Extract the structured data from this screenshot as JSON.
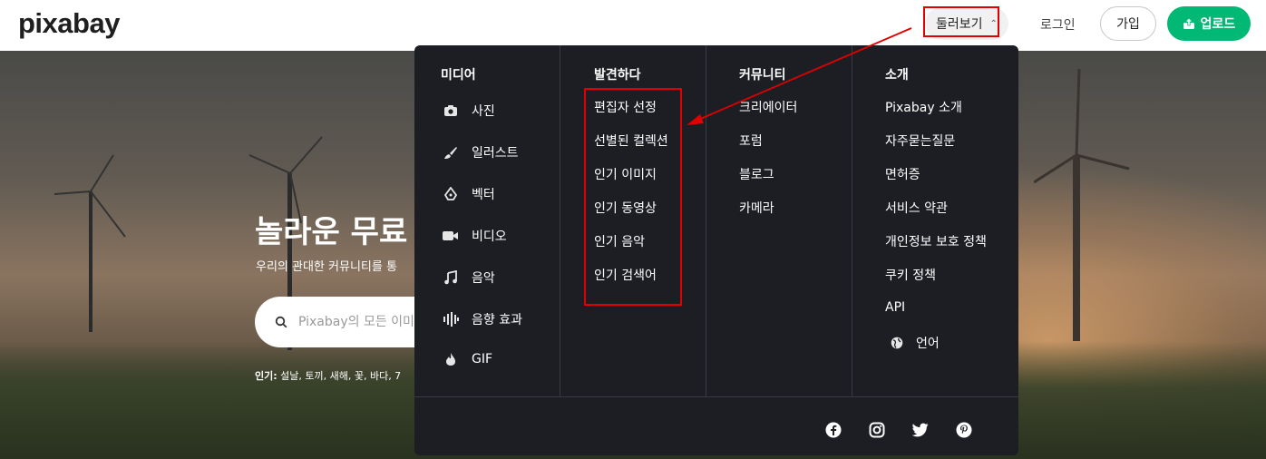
{
  "header": {
    "logo": "pixabay",
    "explore_label": "둘러보기",
    "login_label": "로그인",
    "join_label": "가입",
    "upload_label": "업로드"
  },
  "hero": {
    "title": "놀라운 무료",
    "subtitle": "우리의 관대한 커뮤니티를 통",
    "search_placeholder": "Pixabay의 모든 이미",
    "popular_label": "인기:",
    "popular_terms": "설날, 토끼, 새해, 꽃, 바다, 7"
  },
  "menu": {
    "media": {
      "heading": "미디어",
      "items": [
        {
          "label": "사진",
          "icon": "camera-icon"
        },
        {
          "label": "일러스트",
          "icon": "brush-icon"
        },
        {
          "label": "벡터",
          "icon": "pen-nib-icon"
        },
        {
          "label": "비디오",
          "icon": "video-icon"
        },
        {
          "label": "음악",
          "icon": "music-note-icon"
        },
        {
          "label": "음향 효과",
          "icon": "sound-wave-icon"
        },
        {
          "label": "GIF",
          "icon": "flame-icon"
        }
      ]
    },
    "discover": {
      "heading": "발견하다",
      "items": [
        "편집자 선정",
        "선별된 컬렉션",
        "인기 이미지",
        "인기 동영상",
        "인기 음악",
        "인기 검색어"
      ]
    },
    "community": {
      "heading": "커뮤니티",
      "items": [
        "크리에이터",
        "포럼",
        "블로그",
        "카메라"
      ]
    },
    "about": {
      "heading": "소개",
      "items": [
        "Pixabay 소개",
        "자주묻는질문",
        "면허증",
        "서비스 약관",
        "개인정보 보호 정책",
        "쿠키 정책",
        "API"
      ],
      "language_label": "언어"
    },
    "social": [
      "facebook-icon",
      "instagram-icon",
      "twitter-icon",
      "pinterest-icon"
    ]
  },
  "colors": {
    "brand_green": "#02b875",
    "menu_bg": "#1d1e24",
    "annotation_red": "#e00000"
  }
}
